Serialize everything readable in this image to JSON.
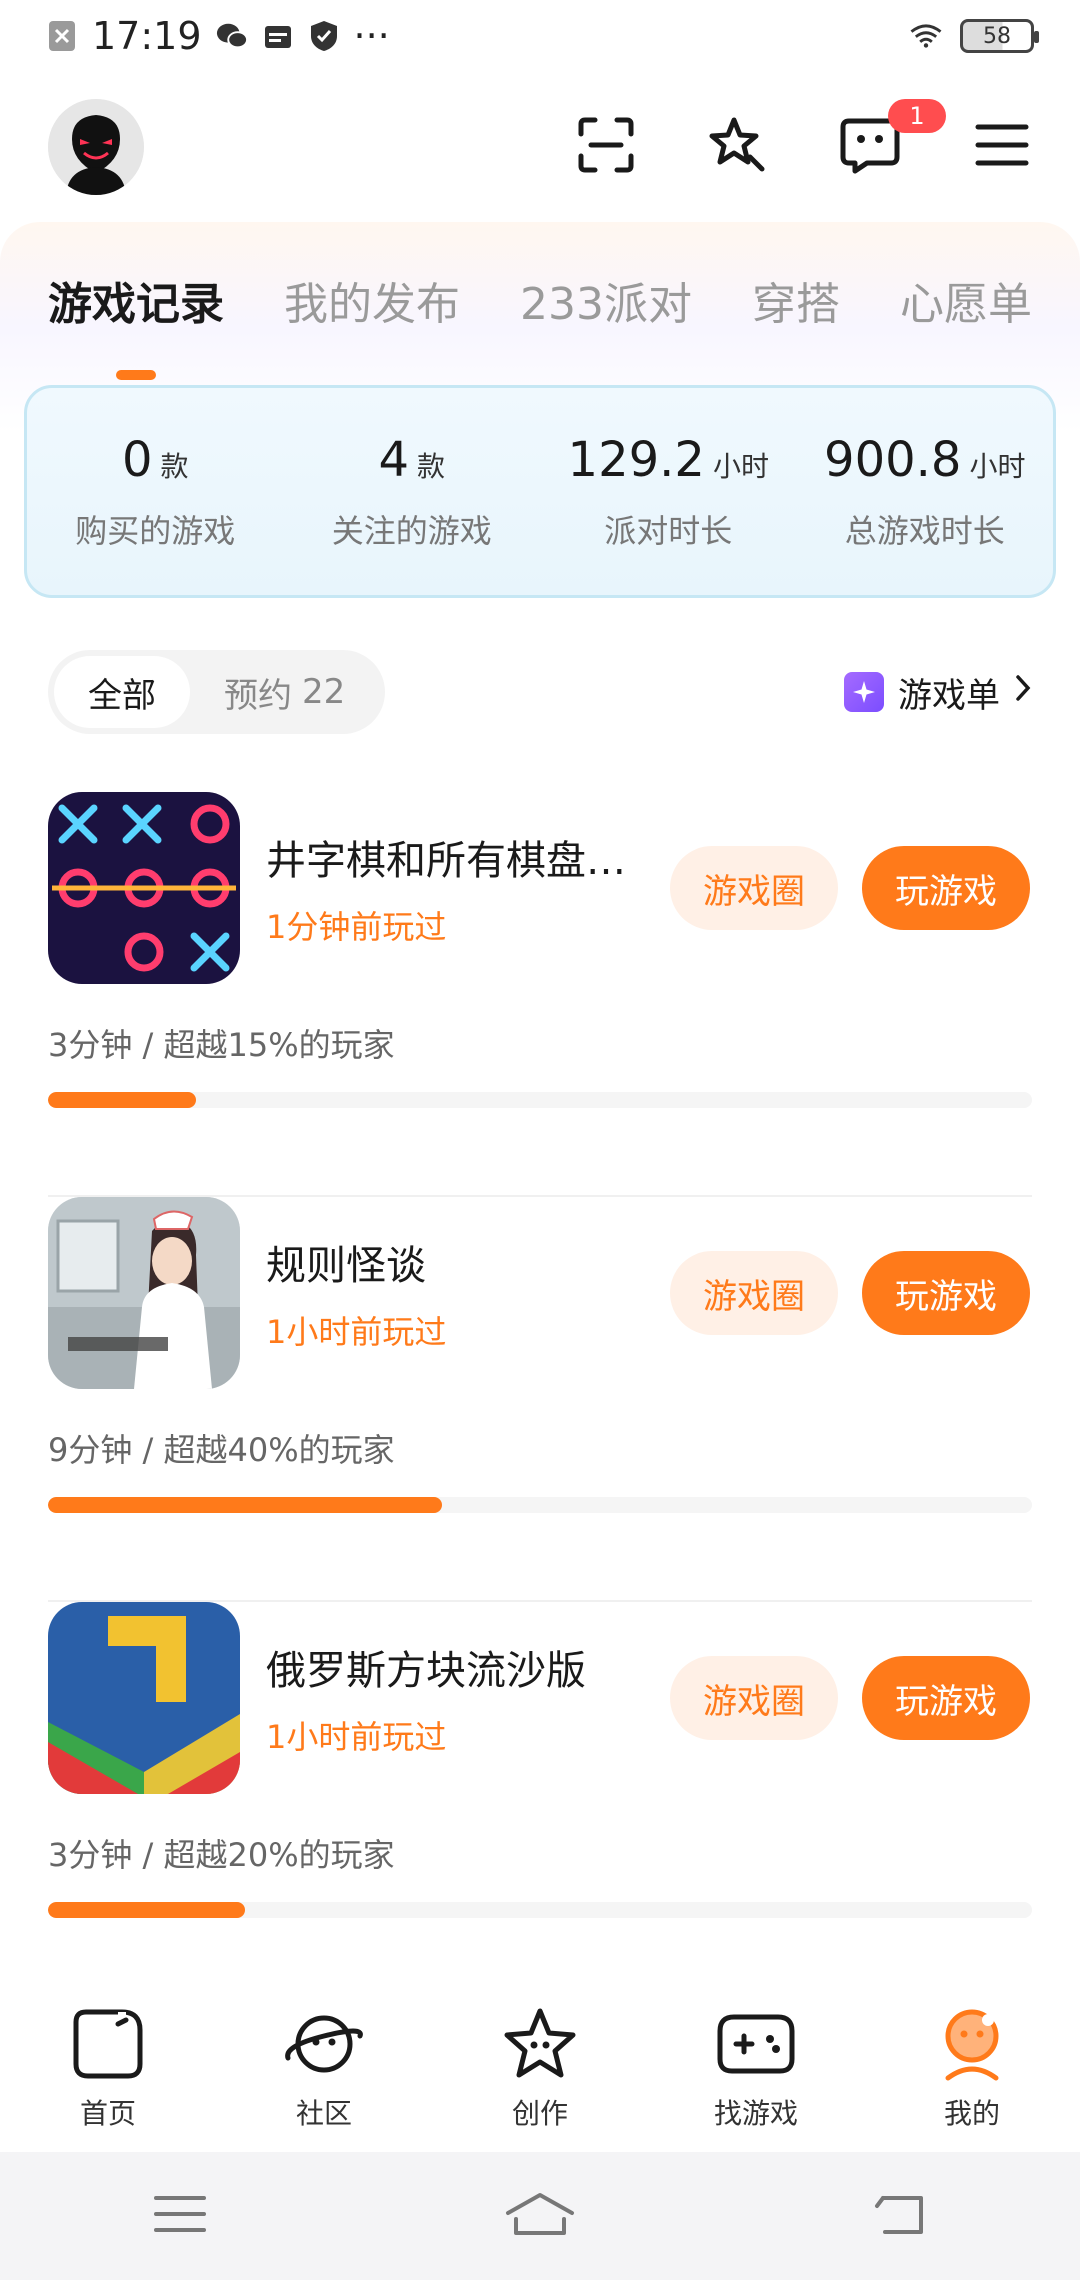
{
  "status_bar": {
    "time": "17:19",
    "more": "···",
    "battery": "58"
  },
  "header": {
    "badge_count": "1"
  },
  "tabs": [
    {
      "label": "游戏记录",
      "active": true
    },
    {
      "label": "我的发布",
      "active": false
    },
    {
      "label": "233派对",
      "active": false
    },
    {
      "label": "穿搭",
      "active": false
    },
    {
      "label": "心愿单",
      "active": false
    }
  ],
  "stats": [
    {
      "value": "0",
      "unit": "款",
      "label": "购买的游戏"
    },
    {
      "value": "4",
      "unit": "款",
      "label": "关注的游戏"
    },
    {
      "value": "129.2",
      "unit": "小时",
      "label": "派对时长"
    },
    {
      "value": "900.8",
      "unit": "小时",
      "label": "总游戏时长"
    }
  ],
  "filter": {
    "all_label": "全部",
    "reserve_label": "预约",
    "reserve_count": "22",
    "playlist_label": "游戏单"
  },
  "games": [
    {
      "name": "井字棋和所有棋盘…",
      "last_played": "1分钟前玩过",
      "circle_label": "游戏圈",
      "play_label": "玩游戏",
      "stat": "3分钟 / 超越15%的玩家",
      "percentile": 15,
      "progress_ratio": 0.15
    },
    {
      "name": "规则怪谈",
      "last_played": "1小时前玩过",
      "circle_label": "游戏圈",
      "play_label": "玩游戏",
      "stat": "9分钟 / 超越40%的玩家",
      "percentile": 40,
      "progress_ratio": 0.4
    },
    {
      "name": "俄罗斯方块流沙版",
      "last_played": "1小时前玩过",
      "circle_label": "游戏圈",
      "play_label": "玩游戏",
      "stat": "3分钟 / 超越20%的玩家",
      "percentile": 20,
      "progress_ratio": 0.2
    }
  ],
  "bottom_nav": [
    {
      "label": "首页",
      "icon": "home-icon",
      "active": false
    },
    {
      "label": "社区",
      "icon": "planet-icon",
      "active": false
    },
    {
      "label": "创作",
      "icon": "star-icon",
      "active": false
    },
    {
      "label": "找游戏",
      "icon": "gamepad-icon",
      "active": false
    },
    {
      "label": "我的",
      "icon": "profile-icon",
      "active": true
    }
  ],
  "colors": {
    "accent": "#ff7a1a",
    "accent_light": "#fff0e6",
    "badge": "#ff4d4f",
    "stats_border": "#c6e7f4"
  }
}
